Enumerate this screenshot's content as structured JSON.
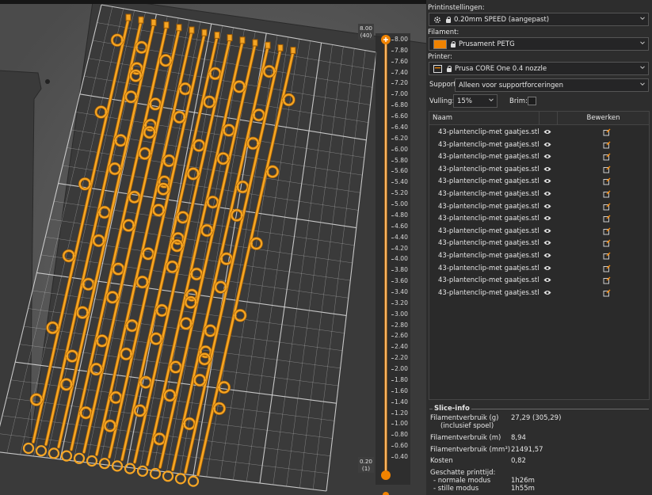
{
  "print_settings": {
    "label": "Printinstellingen:",
    "profile": "0.20mm SPEED (aangepast)"
  },
  "filament": {
    "label": "Filament:",
    "name": "Prusament PETG",
    "color": "#f08300"
  },
  "printer": {
    "label": "Printer:",
    "name": "Prusa CORE One 0.4 nozzle"
  },
  "support": {
    "label": "Support:",
    "value": "Alleen voor supportforceringen"
  },
  "infill": {
    "label": "Vulling:",
    "value": "15%"
  },
  "brim": {
    "label": "Brim:",
    "checked": false
  },
  "object_list": {
    "col_name": "Naam",
    "col_edit": "Bewerken",
    "items": [
      "43-plantenclip-met gaatjes.stl",
      "43-plantenclip-met gaatjes.stl",
      "43-plantenclip-met gaatjes.stl",
      "43-plantenclip-met gaatjes.stl",
      "43-plantenclip-met gaatjes.stl",
      "43-plantenclip-met gaatjes.stl",
      "43-plantenclip-met gaatjes.stl",
      "43-plantenclip-met gaatjes.stl",
      "43-plantenclip-met gaatjes.stl",
      "43-plantenclip-met gaatjes.stl",
      "43-plantenclip-met gaatjes.stl",
      "43-plantenclip-met gaatjes.stl",
      "43-plantenclip-met gaatjes.stl",
      "43-plantenclip-met gaatjes.stl"
    ]
  },
  "slice_info": {
    "title": "Slice-info",
    "filament_g_label": "Filamentverbruik (g)",
    "filament_g_sub": "(inclusief spoel)",
    "filament_g_value": "27,29 (305,29)",
    "filament_m_label": "Filamentverbruik (m)",
    "filament_m_value": "8,94",
    "filament_mm3_label": "Filamentverbruik (mm³)",
    "filament_mm3_value": "21491,57",
    "cost_label": "Kosten",
    "cost_value": "0,82",
    "time_label": "Geschatte printtijd:",
    "normal_label": "- normale modus",
    "normal_value": "1h26m",
    "stealth_label": "- stille modus",
    "stealth_value": "1h55m"
  },
  "layer_slider": {
    "top_height": "8.00",
    "top_layer": "(40)",
    "bottom_height": "0.20",
    "bottom_layer": "(1)",
    "ticks": [
      "8.00",
      "7.80",
      "7.60",
      "7.40",
      "7.20",
      "7.00",
      "6.80",
      "6.60",
      "6.40",
      "6.20",
      "6.00",
      "5.80",
      "5.60",
      "5.40",
      "5.20",
      "5.00",
      "4.80",
      "4.60",
      "4.40",
      "4.20",
      "4.00",
      "3.80",
      "3.60",
      "3.40",
      "3.20",
      "3.00",
      "2.80",
      "2.60",
      "2.40",
      "2.20",
      "2.00",
      "1.80",
      "1.60",
      "1.40",
      "1.20",
      "1.00",
      "0.80",
      "0.60",
      "0.40"
    ],
    "accent": "#f08300"
  },
  "preview_colors": {
    "bed": "#3a3a3a",
    "grid": "#d6d6d6",
    "part": "#f5a524",
    "part_dark": "#a15c00"
  }
}
